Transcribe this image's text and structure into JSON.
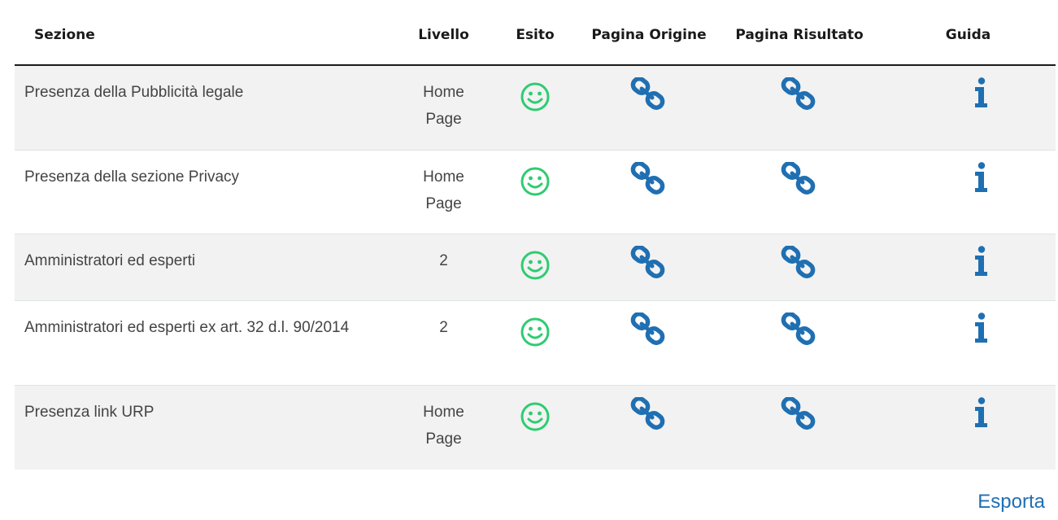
{
  "table": {
    "headers": {
      "sezione": "Sezione",
      "livello": "Livello",
      "esito": "Esito",
      "pagina_origine": "Pagina Origine",
      "pagina_risultato": "Pagina Risultato",
      "guida": "Guida"
    },
    "rows": [
      {
        "sezione": "Presenza della Pubblicità legale",
        "livello": "Home Page",
        "esito": "smiley-icon",
        "origine": "link-icon",
        "risultato": "link-icon",
        "guida": "info-icon"
      },
      {
        "sezione": "Presenza della sezione Privacy",
        "livello": "Home Page",
        "esito": "smiley-icon",
        "origine": "link-icon",
        "risultato": "link-icon",
        "guida": "info-icon"
      },
      {
        "sezione": "Amministratori ed esperti",
        "livello": "2",
        "esito": "smiley-icon",
        "origine": "link-icon",
        "risultato": "link-icon",
        "guida": "info-icon"
      },
      {
        "sezione": "Amministratori ed esperti ex art. 32 d.l. 90/2014",
        "livello": "2",
        "esito": "smiley-icon",
        "origine": "link-icon",
        "risultato": "link-icon",
        "guida": "info-icon"
      },
      {
        "sezione": "Presenza link URP",
        "livello": "Home Page",
        "esito": "smiley-icon",
        "origine": "link-icon",
        "risultato": "link-icon",
        "guida": "info-icon"
      }
    ]
  },
  "export_label": "Esporta",
  "colors": {
    "smiley": "#2ecc71",
    "link": "#1f6fb2",
    "info": "#1f6fb2",
    "row_alt": "#f2f2f2"
  }
}
